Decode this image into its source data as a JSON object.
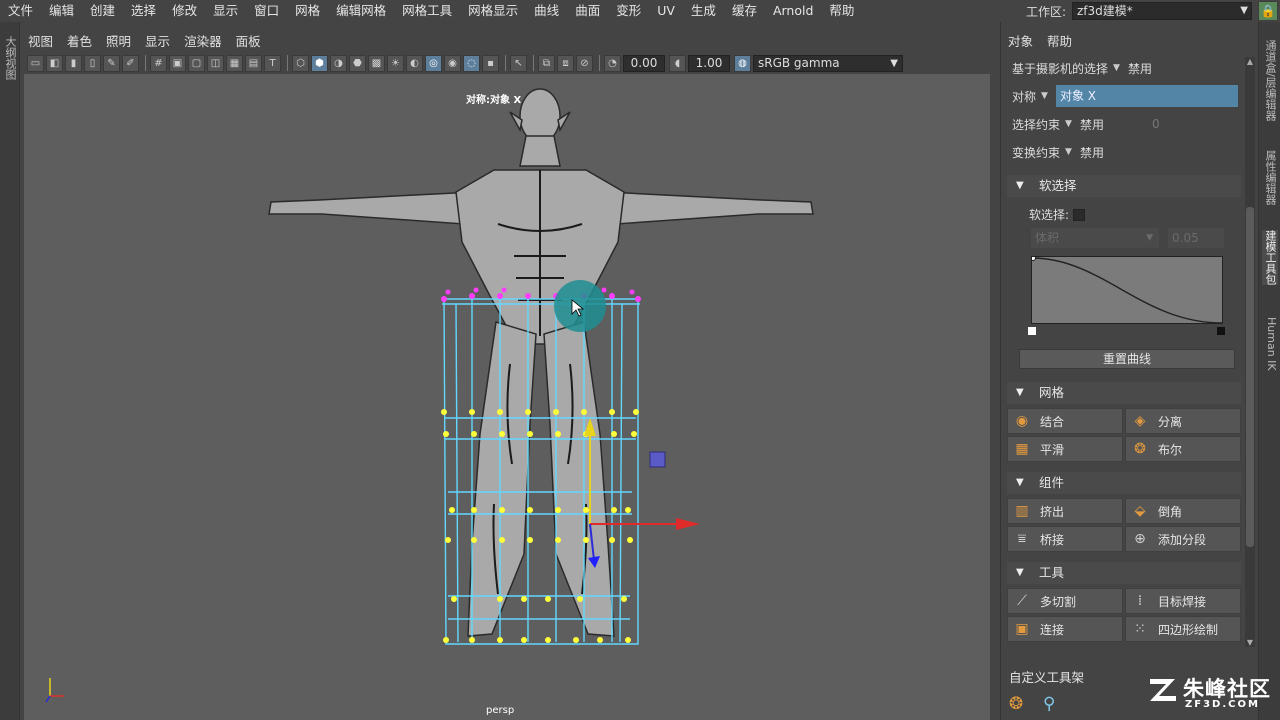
{
  "menubar": {
    "items": [
      "文件",
      "编辑",
      "创建",
      "选择",
      "修改",
      "显示",
      "窗口",
      "网格",
      "编辑网格",
      "网格工具",
      "网格显示",
      "曲线",
      "曲面",
      "变形",
      "UV",
      "生成",
      "缓存",
      "Arnold",
      "帮助"
    ],
    "workspace_label": "工作区:",
    "workspace_value": "zf3d建模*"
  },
  "left_strip": {
    "tab": "大纲视图"
  },
  "viewport_panel": {
    "menu": [
      "视图",
      "着色",
      "照明",
      "显示",
      "渲染器",
      "面板"
    ],
    "exposure": "0.00",
    "gamma": "1.00",
    "color_space": "sRGB gamma",
    "symmetry_label": "对称:对象 X",
    "camera_label": "persp"
  },
  "right_panel": {
    "menu": [
      "对象",
      "帮助"
    ],
    "camera_selection_label": "基于摄影机的选择",
    "camera_selection_value": "禁用",
    "symmetry_label": "对称",
    "symmetry_value": "对象 X",
    "select_constraint_label": "选择约束",
    "select_constraint_value": "禁用",
    "select_constraint_num": "0",
    "transform_constraint_label": "变换约束",
    "transform_constraint_value": "禁用",
    "soft_select": {
      "title": "软选择",
      "checkbox_label": "软选择:",
      "falloff_mode": "体积",
      "falloff_radius": "0.05",
      "reset_button": "重置曲线"
    },
    "mesh": {
      "title": "网格",
      "buttons": [
        "结合",
        "分离",
        "平滑",
        "布尔"
      ]
    },
    "components": {
      "title": "组件",
      "buttons": [
        "挤出",
        "倒角",
        "桥接",
        "添加分段"
      ]
    },
    "tools": {
      "title": "工具",
      "buttons": [
        "多切割",
        "目标焊接",
        "连接",
        "四边形绘制"
      ]
    },
    "shelf_title": "自定义工具架"
  },
  "right_tabs": [
    "通道盒/层编辑器",
    "属性编辑器",
    "建模工具包",
    "Human IK"
  ],
  "watermark": {
    "name": "朱峰社区",
    "site": "ZF3D.COM"
  },
  "colors": {
    "accent_blue": "#5285a6",
    "lattice_cyan": "#63d7ff",
    "lattice_points": "#ffff3a",
    "magenta_points": "#ff3dff",
    "brand_orange": "#e39a3f"
  }
}
